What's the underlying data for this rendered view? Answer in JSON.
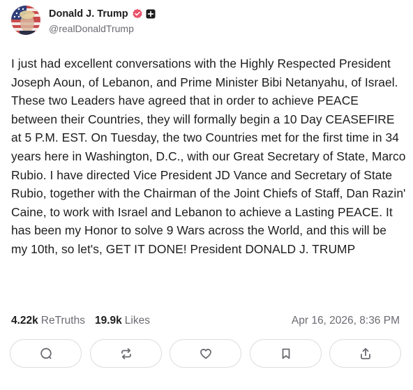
{
  "post": {
    "author": {
      "display_name": "Donald J. Trump",
      "handle": "@realDonaldTrump",
      "verified_icon": "verified-badge-icon",
      "plus_icon": "plus-badge-icon"
    },
    "text": "I just had excellent conversations with the Highly Respected President Joseph Aoun, of Lebanon, and Prime Minister Bibi Netanyahu, of Israel. These two Leaders have agreed that in order to achieve PEACE between their Countries, they will formally begin a 10 Day CEASEFIRE at 5 P.M. EST. On Tuesday, the two Countries met for the first time in 34 years here in Washington, D.C., with our Great Secretary of State, Marco Rubio. I have directed Vice President JD Vance and Secretary of State Rubio, together with the Chairman of the Joint Chiefs of Staff, Dan Razin' Caine, to work with Israel and Lebanon to achieve a Lasting PEACE. It has been my Honor to solve 9 Wars across the World, and this will be my 10th, so let's, GET IT DONE! President DONALD J. TRUMP",
    "stats": {
      "retruths_count": "4.22k",
      "retruths_label": "ReTruths",
      "likes_count": "19.9k",
      "likes_label": "Likes"
    },
    "timestamp": "Apr 16, 2026, 8:36 PM",
    "actions": [
      "reply-icon",
      "retruth-icon",
      "like-icon",
      "bookmark-icon",
      "share-icon"
    ]
  },
  "colors": {
    "text_primary": "#1d1d1f",
    "text_secondary": "#6b6b72",
    "verified": "#e8506a",
    "button_border": "#dcdce0",
    "icon": "#6b6b72"
  }
}
